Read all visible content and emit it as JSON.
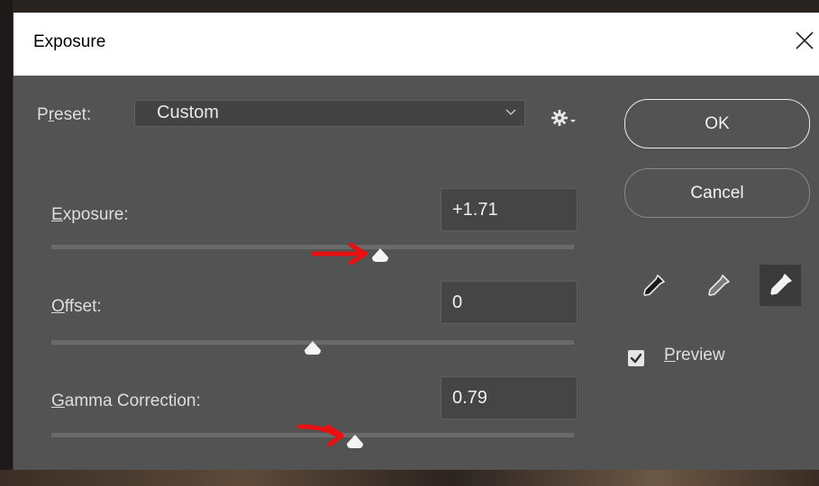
{
  "window": {
    "title": "Exposure"
  },
  "preset": {
    "label_prefix": "P",
    "label_underlined": "r",
    "label_suffix": "eset:",
    "value": "Custom"
  },
  "exposure": {
    "label_underlined": "E",
    "label_rest": "xposure:",
    "value": "+1.71",
    "slider_fraction": 0.62
  },
  "offset": {
    "label_underlined": "O",
    "label_rest": "ffset:",
    "value": "0",
    "slider_fraction": 0.5
  },
  "gamma": {
    "label_underlined": "G",
    "label_rest": "amma Correction:",
    "value": "0.79",
    "slider_fraction": 0.58
  },
  "buttons": {
    "ok": "OK",
    "cancel": "Cancel"
  },
  "preview": {
    "label_underlined": "P",
    "label_rest": "review",
    "checked": true
  },
  "annotation_color": "#e81010",
  "eyedroppers": [
    "black-point-eyedropper-icon",
    "gray-point-eyedropper-icon",
    "white-point-eyedropper-icon"
  ]
}
